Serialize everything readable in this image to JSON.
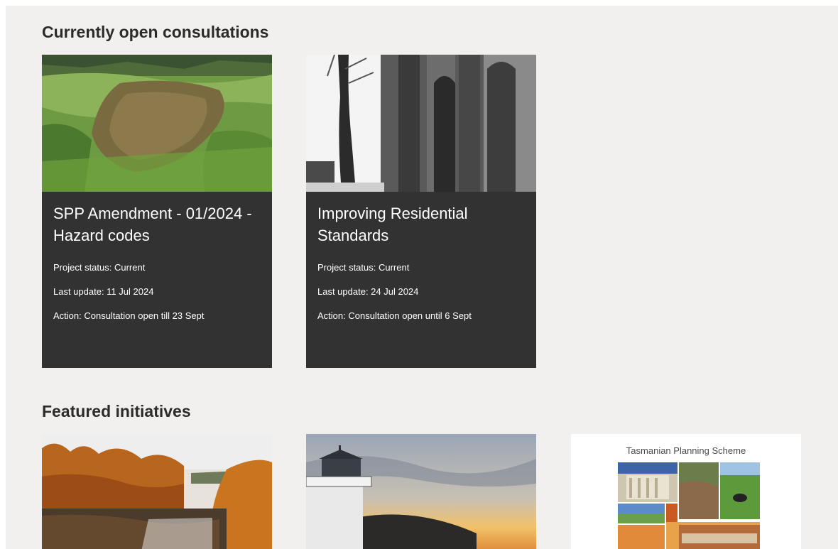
{
  "sections": {
    "consultations_heading": "Currently open consultations",
    "initiatives_heading": "Featured initiatives"
  },
  "consultations": [
    {
      "title": "SPP Amendment - 01/2024 - Hazard codes",
      "status": "Project status: Current",
      "last_update": "Last update: 11 Jul 2024",
      "action": "Action: Consultation open till 23 Sept"
    },
    {
      "title": "Improving Residential Standards",
      "status": "Project status: Current",
      "last_update": "Last update: 24 Jul 2024",
      "action": "Action: Consultation open until 6 Sept"
    }
  ],
  "initiatives": [
    {
      "caption": ""
    },
    {
      "caption": ""
    },
    {
      "caption": "Tasmanian Planning Scheme"
    }
  ],
  "colors": {
    "panel_background": "#f1f0ee",
    "card_background": "#323232",
    "heading_text": "#2b2b2b"
  },
  "images": {
    "card_1": "aerial-green-hillside-landslide-photo",
    "card_2": "city-street-heritage-buildings-photo",
    "feature_1": "autumn-river-trees-photo",
    "feature_2": "lighthouse-sunset-photo",
    "feature_3": "planning-scheme-collage-photo"
  }
}
